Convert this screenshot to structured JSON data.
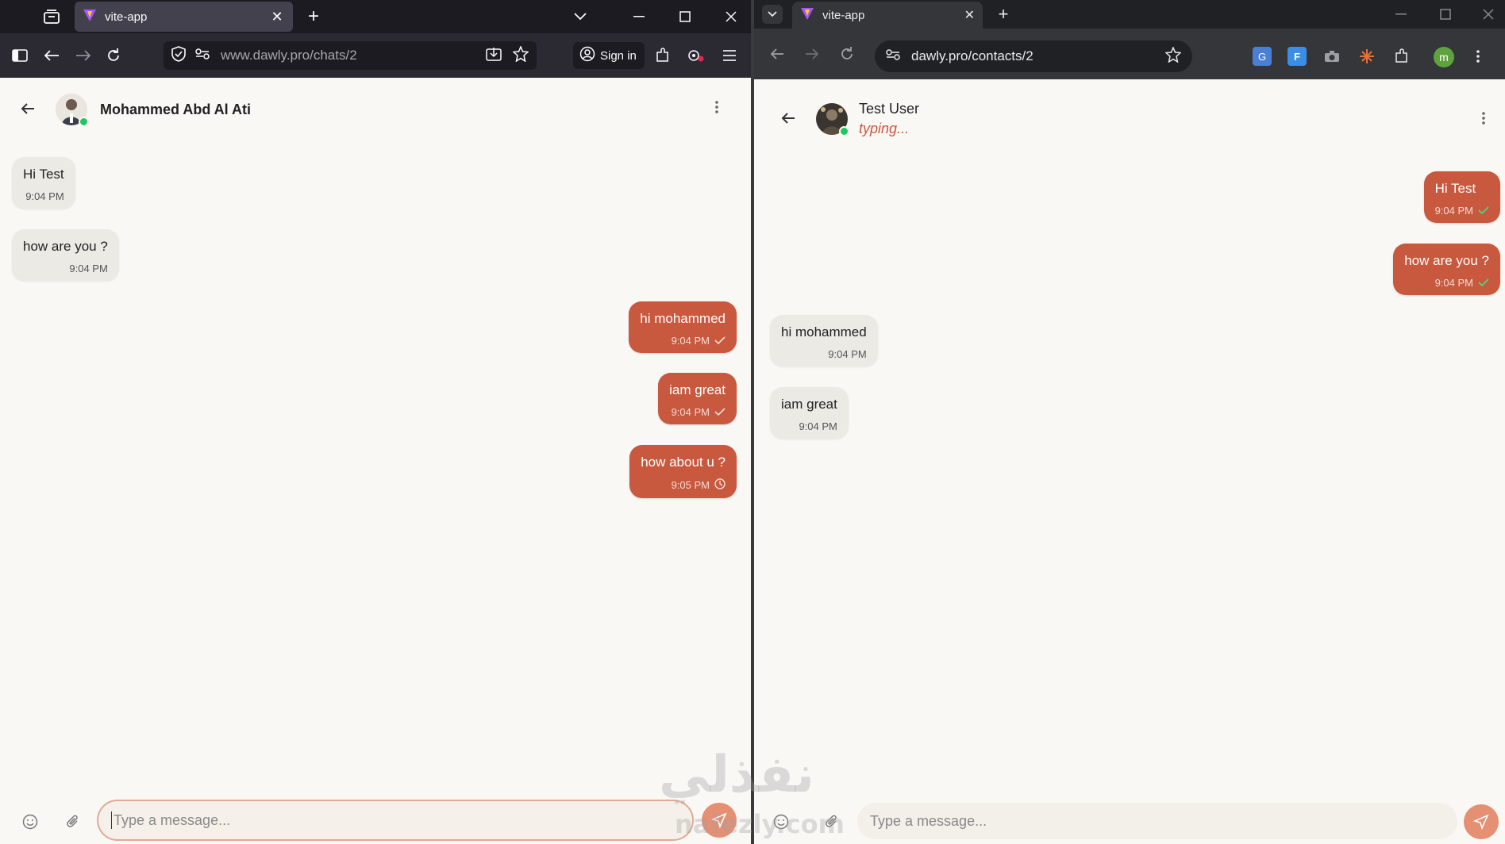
{
  "left_browser": {
    "tab_title": "vite-app",
    "url_domain": "www.dawly.pro",
    "url_path": "/chats/2",
    "signin_label": "Sign in"
  },
  "right_browser": {
    "tab_title": "vite-app",
    "url": "dawly.pro/contacts/2",
    "profile_initial": "m"
  },
  "left_chat": {
    "contact_name": "Mohammed Abd Al Ati",
    "messages": [
      {
        "text": "Hi Test",
        "time": "9:04 PM",
        "dir": "in"
      },
      {
        "text": "how are you ?",
        "time": "9:04 PM",
        "dir": "in"
      },
      {
        "text": "hi mohammed",
        "time": "9:04 PM",
        "dir": "out",
        "status": "sent"
      },
      {
        "text": "iam great",
        "time": "9:04 PM",
        "dir": "out",
        "status": "sent"
      },
      {
        "text": "how about u ?",
        "time": "9:05 PM",
        "dir": "out",
        "status": "pending"
      }
    ],
    "input_placeholder": "Type a message..."
  },
  "right_chat": {
    "contact_name": "Test User",
    "status_text": "typing...",
    "messages": [
      {
        "text": "Hi Test",
        "time": "9:04 PM",
        "dir": "out",
        "status": "read"
      },
      {
        "text": "how are you ?",
        "time": "9:04 PM",
        "dir": "out",
        "status": "read"
      },
      {
        "text": "hi mohammed",
        "time": "9:04 PM",
        "dir": "in"
      },
      {
        "text": "iam great",
        "time": "9:04 PM",
        "dir": "in"
      }
    ],
    "input_placeholder": "Type a message..."
  },
  "watermark": {
    "main": "نفذلي",
    "sub": "nafezly.com"
  },
  "colors": {
    "accent": "#c8583e",
    "send": "#e58f73",
    "online": "#22c55e",
    "bg": "#faf8f4"
  }
}
